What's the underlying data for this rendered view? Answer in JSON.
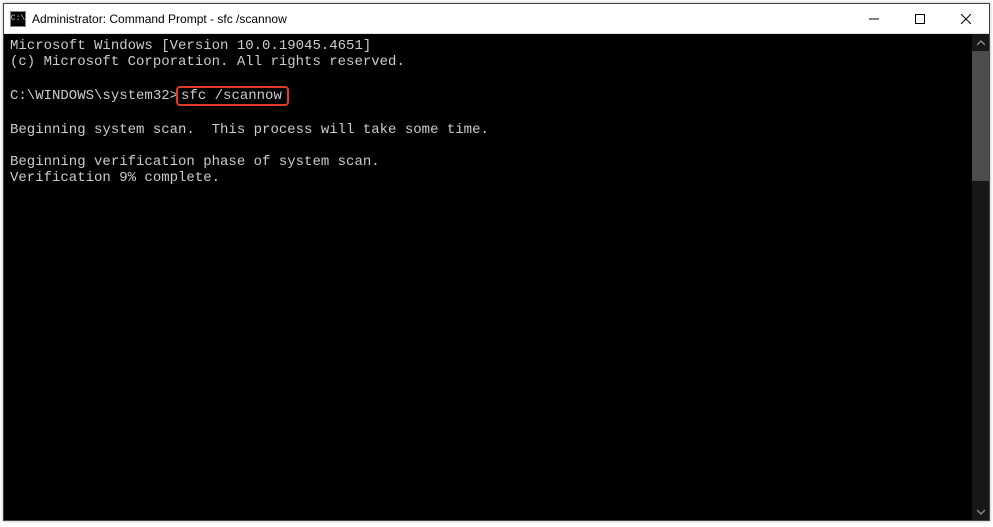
{
  "window": {
    "title": "Administrator: Command Prompt - sfc  /scannow",
    "icon_text": "C:\\"
  },
  "terminal": {
    "line1": "Microsoft Windows [Version 10.0.19045.4651]",
    "line2": "(c) Microsoft Corporation. All rights reserved.",
    "blank1": "",
    "prompt": "C:\\WINDOWS\\system32>",
    "command": "sfc /scannow",
    "blank2": "",
    "line3": "Beginning system scan.  This process will take some time.",
    "blank3": "",
    "line4": "Beginning verification phase of system scan.",
    "line5": "Verification 9% complete."
  },
  "colors": {
    "highlight_border": "#e3392b",
    "terminal_bg": "#000000",
    "terminal_fg": "#cccccc"
  }
}
